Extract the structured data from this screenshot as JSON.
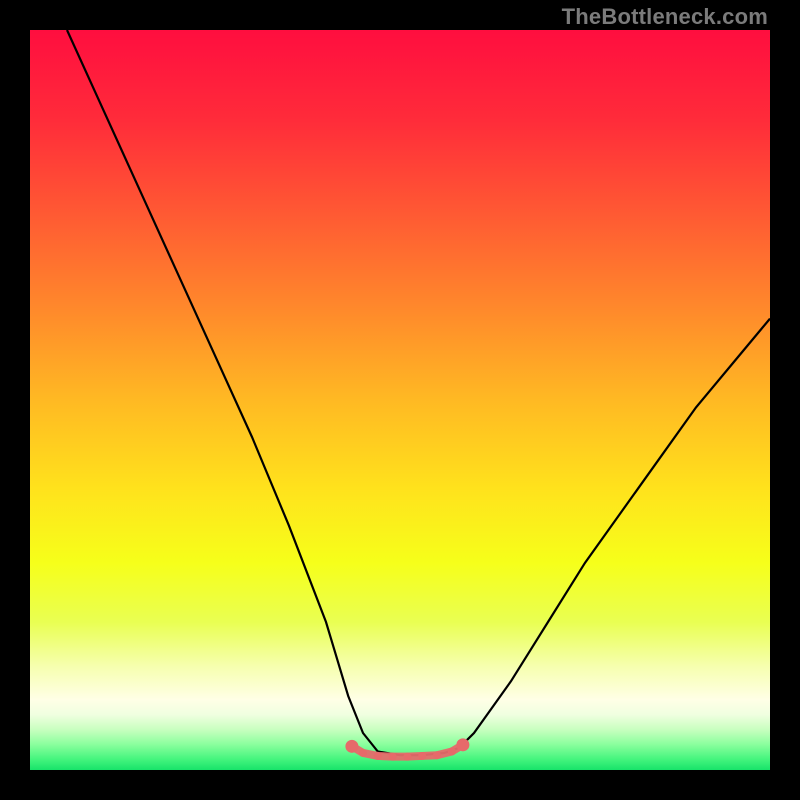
{
  "watermark": "TheBottleneck.com",
  "gradient": {
    "stops": [
      {
        "offset": 0.0,
        "color": "#ff0e3f"
      },
      {
        "offset": 0.12,
        "color": "#ff2b3a"
      },
      {
        "offset": 0.25,
        "color": "#ff5a33"
      },
      {
        "offset": 0.38,
        "color": "#ff8a2b"
      },
      {
        "offset": 0.5,
        "color": "#ffb923"
      },
      {
        "offset": 0.62,
        "color": "#ffe21c"
      },
      {
        "offset": 0.72,
        "color": "#f6ff1a"
      },
      {
        "offset": 0.8,
        "color": "#e9ff52"
      },
      {
        "offset": 0.86,
        "color": "#f6ffaf"
      },
      {
        "offset": 0.905,
        "color": "#ffffe6"
      },
      {
        "offset": 0.925,
        "color": "#f0ffe0"
      },
      {
        "offset": 0.945,
        "color": "#c9ffc0"
      },
      {
        "offset": 0.965,
        "color": "#8cff9e"
      },
      {
        "offset": 0.985,
        "color": "#46f57e"
      },
      {
        "offset": 1.0,
        "color": "#18e36a"
      }
    ]
  },
  "chart_data": {
    "type": "line",
    "title": "",
    "xlabel": "",
    "ylabel": "",
    "xlim": [
      0,
      100
    ],
    "ylim": [
      0,
      100
    ],
    "series": [
      {
        "name": "bottleneck-curve",
        "x": [
          5,
          10,
          15,
          20,
          25,
          30,
          35,
          40,
          43,
          45,
          47,
          50,
          53,
          56,
          58,
          60,
          65,
          70,
          75,
          80,
          85,
          90,
          95,
          100
        ],
        "y": [
          100,
          89,
          78,
          67,
          56,
          45,
          33,
          20,
          10,
          5,
          2.5,
          2,
          2,
          2.3,
          3,
          5,
          12,
          20,
          28,
          35,
          42,
          49,
          55,
          61
        ]
      }
    ],
    "highlight": {
      "name": "bottom-dots",
      "color": "#e66a6a",
      "x": [
        43.5,
        45,
        47,
        49,
        51,
        53,
        55,
        57,
        58.5
      ],
      "y": [
        3.2,
        2.3,
        1.9,
        1.8,
        1.8,
        1.9,
        2.0,
        2.5,
        3.4
      ]
    }
  }
}
